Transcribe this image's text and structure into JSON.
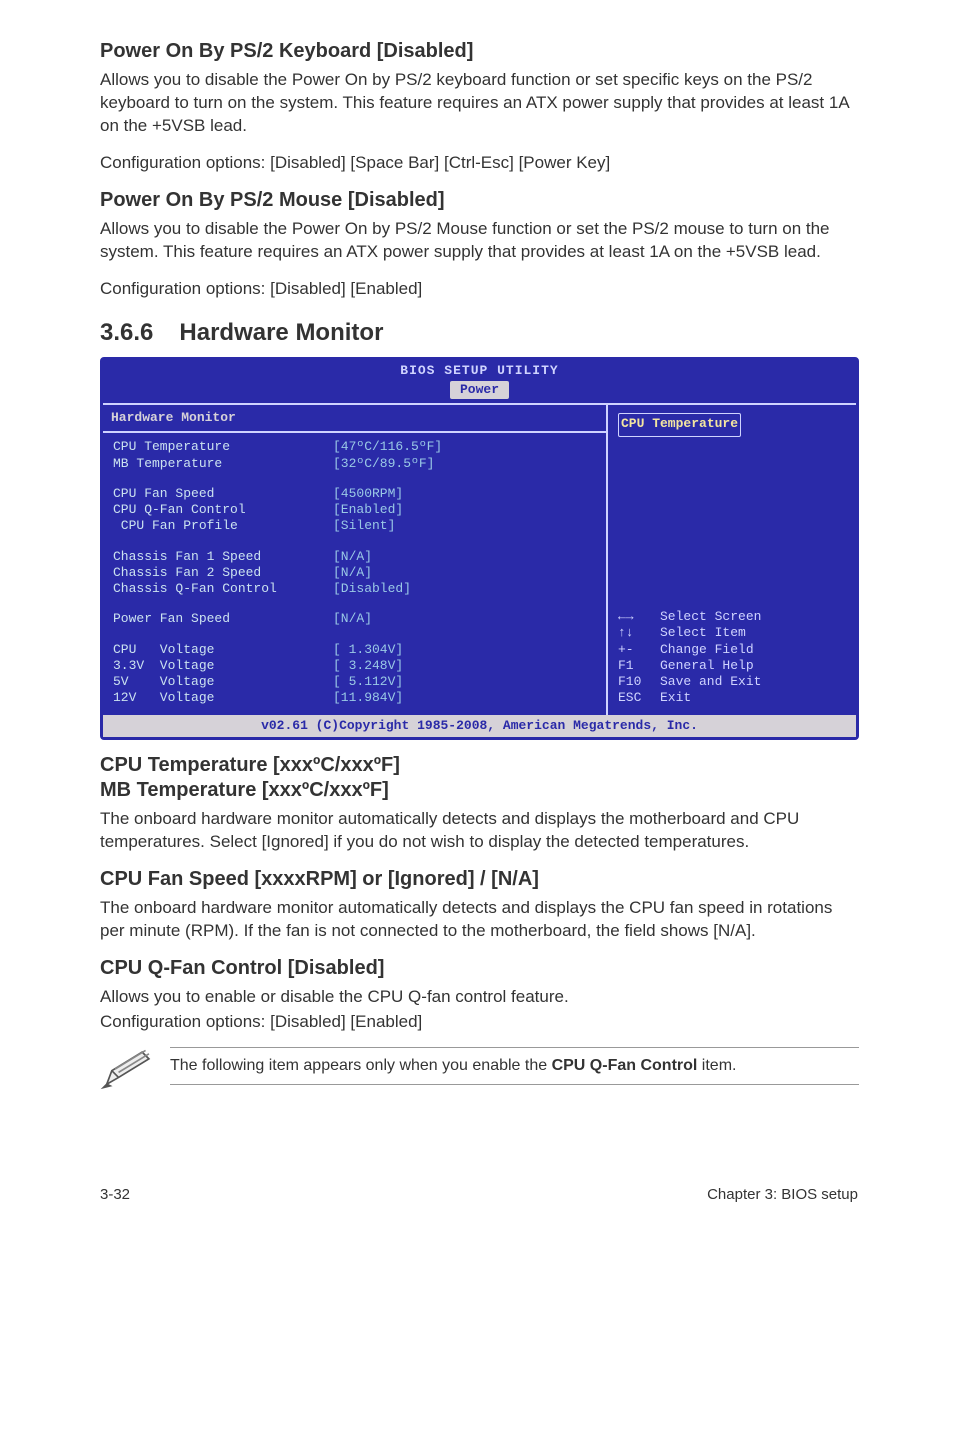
{
  "s1": {
    "heading": "Power On By PS/2 Keyboard [Disabled]",
    "p1": "Allows you to disable the Power On by PS/2 keyboard function or set specific keys on the PS/2 keyboard to turn on the system. This feature requires an ATX power supply that provides at least 1A on the +5VSB lead.",
    "p2": "Configuration options: [Disabled] [Space Bar] [Ctrl-Esc] [Power Key]"
  },
  "s2": {
    "heading": "Power On By PS/2 Mouse [Disabled]",
    "p1": "Allows you to disable the Power On by PS/2 Mouse function or set the PS/2 mouse to turn on the system. This feature requires an ATX power supply that provides at least 1A on the +5VSB lead.",
    "p2": "Configuration options: [Disabled] [Enabled]"
  },
  "subsection_num": "3.6.6",
  "subsection_title": "Hardware Monitor",
  "bios": {
    "title": "BIOS SETUP UTILITY",
    "tab": "Power",
    "section": "Hardware Monitor",
    "rows": [
      {
        "label": "CPU Temperature",
        "value": "[47ºC/116.5ºF]"
      },
      {
        "label": "MB Temperature",
        "value": "[32ºC/89.5ºF]"
      },
      null,
      {
        "label": "CPU Fan Speed",
        "value": "[4500RPM]"
      },
      {
        "label": "CPU Q-Fan Control",
        "value": "[Enabled]"
      },
      {
        "label": " CPU Fan Profile",
        "value": "[Silent]"
      },
      null,
      {
        "label": "Chassis Fan 1 Speed",
        "value": "[N/A]"
      },
      {
        "label": "Chassis Fan 2 Speed",
        "value": "[N/A]"
      },
      {
        "label": "Chassis Q-Fan Control",
        "value": "[Disabled]"
      },
      null,
      {
        "label": "Power Fan Speed",
        "value": "[N/A]"
      },
      null,
      {
        "label": "CPU   Voltage",
        "value": "[ 1.304V]"
      },
      {
        "label": "3.3V  Voltage",
        "value": "[ 3.248V]"
      },
      {
        "label": "5V    Voltage",
        "value": "[ 5.112V]"
      },
      {
        "label": "12V   Voltage",
        "value": "[11.984V]"
      }
    ],
    "right_highlight": "CPU Temperature",
    "help": [
      {
        "key": "←→",
        "text": "Select Screen"
      },
      {
        "key": "↑↓",
        "text": "Select Item"
      },
      {
        "key": "+-",
        "text": "  Change Field"
      },
      {
        "key": "F1",
        "text": "General Help"
      },
      {
        "key": "F10",
        "text": "Save and Exit"
      },
      {
        "key": "ESC",
        "text": "Exit"
      }
    ],
    "footer": "v02.61 (C)Copyright 1985-2008, American Megatrends, Inc."
  },
  "s3": {
    "h_a": "CPU Temperature [xxxºC/xxxºF]",
    "h_b": "MB Temperature [xxxºC/xxxºF]",
    "p": "The onboard hardware monitor automatically detects and displays the motherboard and CPU temperatures. Select [Ignored] if you do not wish to display the detected temperatures."
  },
  "s4": {
    "heading": "CPU Fan Speed [xxxxRPM] or [Ignored] / [N/A]",
    "p": "The onboard hardware monitor automatically detects and displays the CPU fan speed in rotations per minute (RPM). If the fan is not connected to the motherboard, the field shows [N/A]."
  },
  "s5": {
    "heading": "CPU Q-Fan Control [Disabled]",
    "p1": "Allows you to enable or disable the CPU Q-fan control feature.",
    "p2": "Configuration options: [Disabled] [Enabled]"
  },
  "note": {
    "prefix": "The following item appears only when you enable the ",
    "bold": "CPU Q-Fan Control",
    "suffix": " item."
  },
  "footer": {
    "left": "3-32",
    "right": "Chapter 3: BIOS setup"
  }
}
